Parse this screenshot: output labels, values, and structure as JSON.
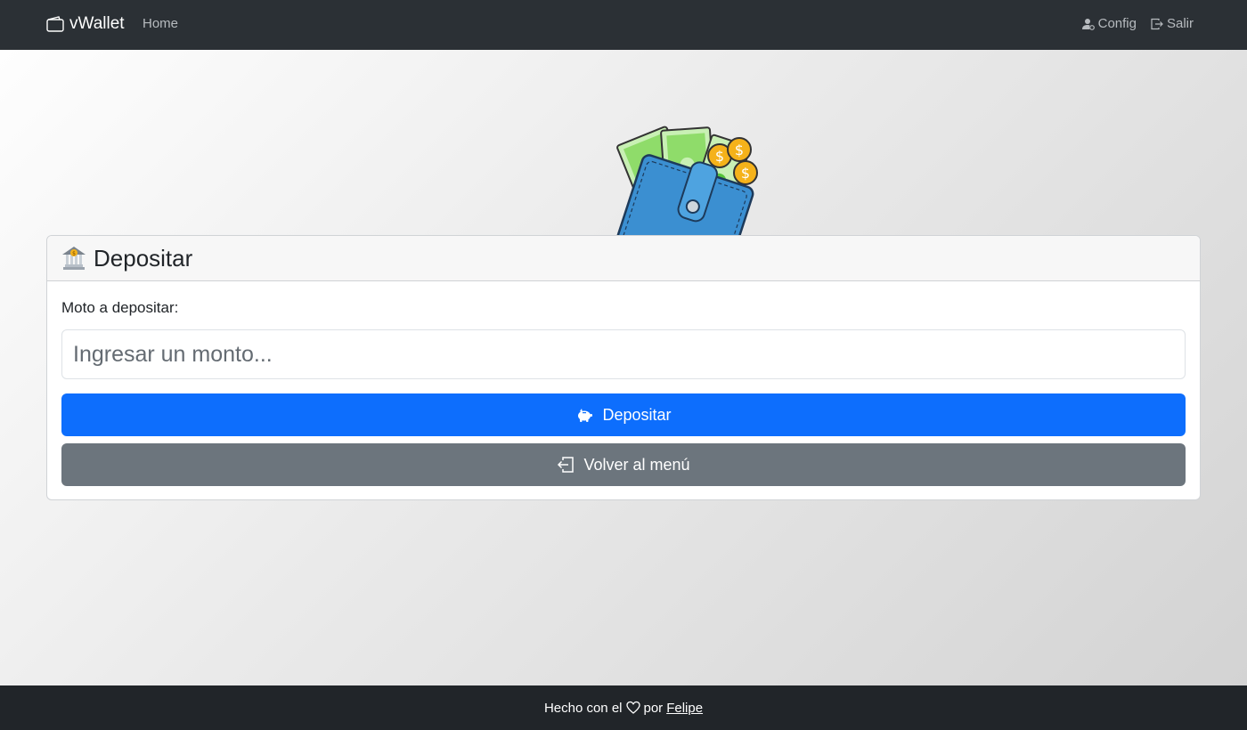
{
  "navbar": {
    "brand": "vWallet",
    "home": "Home",
    "config": "Config",
    "logout": "Salir"
  },
  "card": {
    "title": "Depositar",
    "amount_label": "Moto a depositar:",
    "amount_placeholder": "Ingresar un monto...",
    "deposit_button": "Depositar",
    "back_button": "Volver al menú"
  },
  "footer": {
    "text_before": "Hecho con el",
    "text_after": "por",
    "author": "Felipe"
  },
  "icons": {
    "brand": "wallet-icon",
    "config": "person-gear-icon",
    "logout": "box-arrow-right-icon",
    "bank": "bank-emoji-icon",
    "deposit": "piggy-bank-icon",
    "back": "box-arrow-in-left-icon",
    "heart": "heart-icon"
  },
  "colors": {
    "navbar": "#2b3035",
    "primary": "#0d6efd",
    "secondary": "#6c757d",
    "footer": "#212529"
  }
}
